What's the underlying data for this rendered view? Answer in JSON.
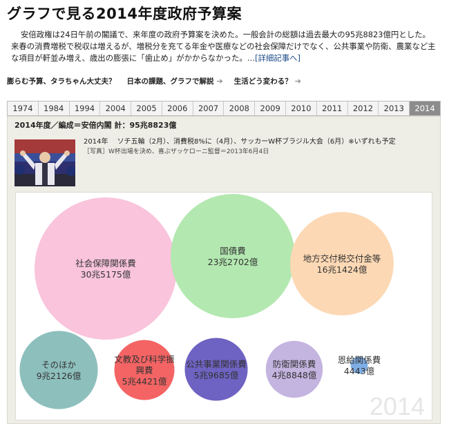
{
  "page": {
    "title": "グラフで見る2014年度政府予算案",
    "intro": "安倍政権は24日午前の閣議で、来年度の政府予算案を決めた。一般会計の総額は過去最大の95兆8823億円とした。来春の消費増税で税収は増えるが、増税分を充てる年金や医療などの社会保障だけでなく、公共事業や防衛、農業など主な項目が軒並み増え、歳出の膨張に「歯止め」がかからなかった。…",
    "detail_link": "[詳細記事へ]"
  },
  "related_links": [
    "膨らむ予算、タラちゃん大丈夫？",
    "日本の課題、グラフで解説",
    "生活どう変わる？"
  ],
  "years": [
    "1974",
    "1984",
    "1994",
    "2004",
    "2005",
    "2006",
    "2007",
    "2008",
    "2009",
    "2010",
    "2011",
    "2012",
    "2013",
    "2014"
  ],
  "selected_year": "2014",
  "summary": "2014年度／編成＝安倍内閣 計：95兆8823億",
  "events": {
    "year": "2014年",
    "text": "ソチ五輪（2月）、消費税8%に（4月）、サッカーW杯ブラジル大会（6月）※いずれも予定",
    "caption": "［写真］W杯出場を決め、喜ぶザッケローニ監督＝2013年6月4日"
  },
  "chart_data": {
    "type": "bubble",
    "unit": "億円",
    "watermark": "2014",
    "items": [
      {
        "name": "社会保障関係費",
        "label": "30兆5175億",
        "value": 305175,
        "color": "#f9c4dc"
      },
      {
        "name": "国債費",
        "label": "23兆2702億",
        "value": 232702,
        "color": "#b3e8b0"
      },
      {
        "name": "地方交付税交付金等",
        "label": "16兆1424億",
        "value": 161424,
        "color": "#fcd8b4"
      },
      {
        "name": "そのほか",
        "label": "9兆2126億",
        "value": 92126,
        "color": "#8dbfbd"
      },
      {
        "name": "文教及び科学振興費",
        "label": "5兆4421億",
        "value": 54421,
        "color": "#f46464"
      },
      {
        "name": "公共事業関係費",
        "label": "5兆9685億",
        "value": 59685,
        "color": "#6e62c2"
      },
      {
        "name": "防衛関係費",
        "label": "4兆8848億",
        "value": 48848,
        "color": "#c4b4e0"
      },
      {
        "name": "恩給関係費",
        "label": "4443億",
        "value": 4443,
        "color": "#7faee6"
      }
    ]
  }
}
